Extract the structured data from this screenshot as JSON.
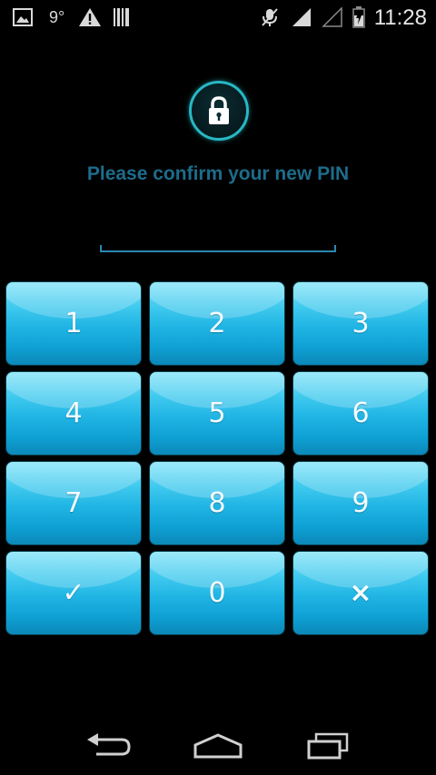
{
  "status_bar": {
    "temperature": "9°",
    "time": "11:28",
    "icons": [
      "gallery-icon",
      "weather-icon",
      "warning-icon",
      "barcode-icon",
      "mute-icon",
      "signal-icon",
      "signal-empty-icon",
      "battery-icon"
    ]
  },
  "screen": {
    "title": "Please confirm your new PIN",
    "pin_value": ""
  },
  "keypad": {
    "keys": [
      {
        "label": "1",
        "name": "key-1"
      },
      {
        "label": "2",
        "name": "key-2"
      },
      {
        "label": "3",
        "name": "key-3"
      },
      {
        "label": "4",
        "name": "key-4"
      },
      {
        "label": "5",
        "name": "key-5"
      },
      {
        "label": "6",
        "name": "key-6"
      },
      {
        "label": "7",
        "name": "key-7"
      },
      {
        "label": "8",
        "name": "key-8"
      },
      {
        "label": "9",
        "name": "key-9"
      },
      {
        "label": "✓",
        "name": "confirm-key"
      },
      {
        "label": "0",
        "name": "key-0"
      },
      {
        "label": "×",
        "name": "clear-key"
      }
    ]
  },
  "colors": {
    "accent": "#27b8c4",
    "title": "#1d6c8b",
    "key_top": "#7fe3f8",
    "key_bottom": "#0b88b8"
  }
}
